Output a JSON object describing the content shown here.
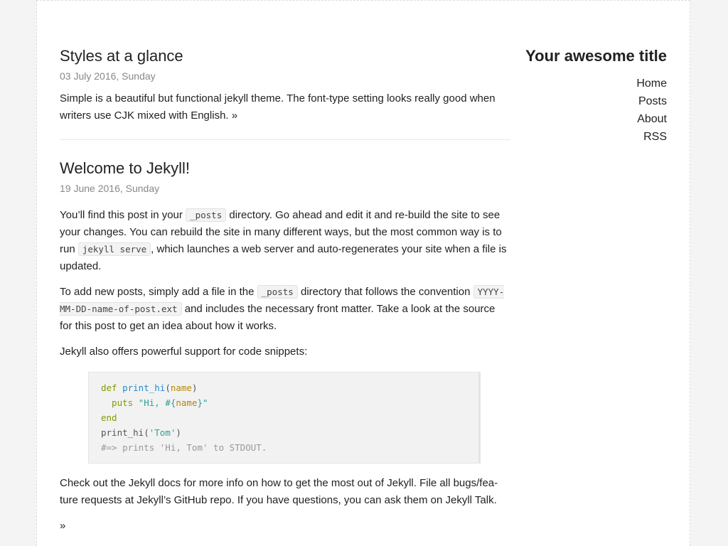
{
  "sidebar": {
    "site_title": "Your awesome title",
    "nav": [
      {
        "label": "Home"
      },
      {
        "label": "Posts"
      },
      {
        "label": "About"
      },
      {
        "label": "RSS"
      }
    ]
  },
  "posts": [
    {
      "title": "Styles at a glance",
      "date": "03 July 2016, Sunday",
      "excerpt": "Simple is a beautiful but functional jekyll theme. The font-type setting looks really good when writers use CJK mixed with English.",
      "more": "»"
    },
    {
      "title": "Welcome to Jekyll!",
      "date": "19 June 2016, Sunday",
      "p1": {
        "a": "You’ll find this post in your ",
        "code1": "_posts",
        "b": " directory. Go ahead and edit it and re-build the site to see your changes. You can rebuild the site in many different ways, but the most common way is to run ",
        "code2": "jekyll serve",
        "c": ", which launches a web server and auto-regenerates your site when a file is updated."
      },
      "p2": {
        "a": "To add new posts, simply add a file in the ",
        "code1": "_posts",
        "b": " directory that follows the convention ",
        "code2": "YYYY-MM-DD-name-of-post.ext",
        "c": " and includes the necessary front matter. Take a look at the source for this post to get an idea about how it works."
      },
      "p3": "Jekyll also offers powerful support for code snippets:",
      "code": {
        "l1_kw": "def",
        "l1_fn": "print_hi",
        "l1_open": "(",
        "l1_var": "name",
        "l1_close": ")",
        "l2_indent": "  puts ",
        "l2_str_a": "\"Hi, #{",
        "l2_var": "name",
        "l2_str_b": "}\"",
        "l3_kw": "end",
        "l4_fn": "print_hi",
        "l4_open": "(",
        "l4_str": "'Tom'",
        "l4_close": ")",
        "l5_comment": "#=> prints 'Hi, Tom' to STDOUT."
      },
      "p4": "Check out the Jekyll docs for more info on how to get the most out of Jekyll. File all bugs/fea­ture requests at Jekyll’s GitHub repo. If you have questions, you can ask them on Jekyll Talk.",
      "more": "»"
    }
  ]
}
